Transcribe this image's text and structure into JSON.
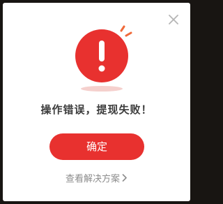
{
  "dialog": {
    "close_icon": "close-icon",
    "alert_icon": "exclamation-alert-icon",
    "message": "操作错误，提现失败！",
    "confirm_label": "确定",
    "solution_label": "查看解决方案",
    "chevron_icon": "chevron-right-icon"
  },
  "colors": {
    "accent": "#e8312f",
    "message_text": "#3c3c3c",
    "link_text": "#8c8c8c",
    "background": "#ffffff"
  }
}
